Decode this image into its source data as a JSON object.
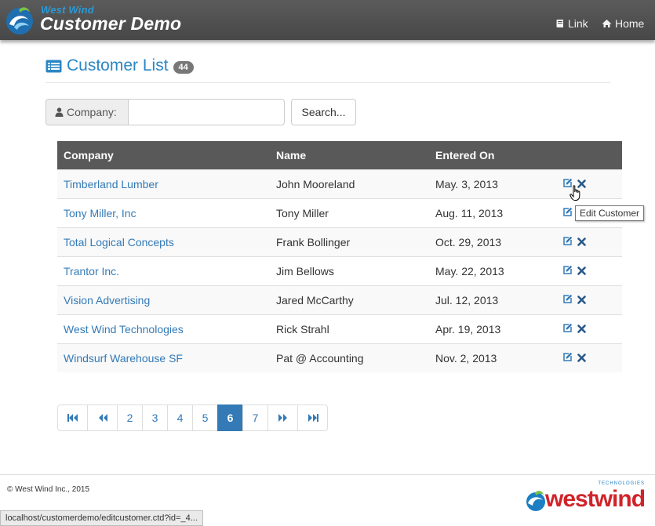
{
  "header": {
    "brand_top": "West Wind",
    "brand_title": "Customer Demo",
    "nav": [
      {
        "label": "Link",
        "icon": "book-icon"
      },
      {
        "label": "Home",
        "icon": "home-icon"
      }
    ]
  },
  "page": {
    "title": "Customer List",
    "count_badge": "44"
  },
  "search": {
    "label": "Company:",
    "value": "",
    "button_label": "Search..."
  },
  "table": {
    "headers": [
      "Company",
      "Name",
      "Entered On"
    ],
    "rows": [
      {
        "company": "Timberland Lumber",
        "name": "John Mooreland",
        "entered": "May. 3, 2013"
      },
      {
        "company": "Tony Miller, Inc",
        "name": "Tony Miller",
        "entered": "Aug. 11, 2013"
      },
      {
        "company": "Total Logical Concepts",
        "name": "Frank Bollinger",
        "entered": "Oct. 29, 2013"
      },
      {
        "company": "Trantor Inc.",
        "name": "Jim Bellows",
        "entered": "May. 22, 2013"
      },
      {
        "company": "Vision Advertising",
        "name": "Jared McCarthy",
        "entered": "Jul. 12, 2013"
      },
      {
        "company": "West Wind Technologies",
        "name": "Rick Strahl",
        "entered": "Apr. 19, 2013"
      },
      {
        "company": "Windsurf Warehouse SF",
        "name": "Pat @ Accounting",
        "entered": "Nov. 2, 2013"
      }
    ]
  },
  "tooltip": "Edit Customer",
  "pagination": {
    "pages": [
      "2",
      "3",
      "4",
      "5",
      "6",
      "7"
    ],
    "active": "6"
  },
  "footer": {
    "copyright": "© West Wind Inc., 2015",
    "logo_text": "westwind",
    "logo_tagline": "TECHNOLOGIES",
    "status_url": "localhost/customerdemo/editcustomer.ctd?id=_4..."
  },
  "colors": {
    "accent": "#2a87c4",
    "link": "#337ab7",
    "header_bg": "#4f4f4f",
    "table_header_bg": "#595959",
    "logo_red": "#d1232a"
  }
}
